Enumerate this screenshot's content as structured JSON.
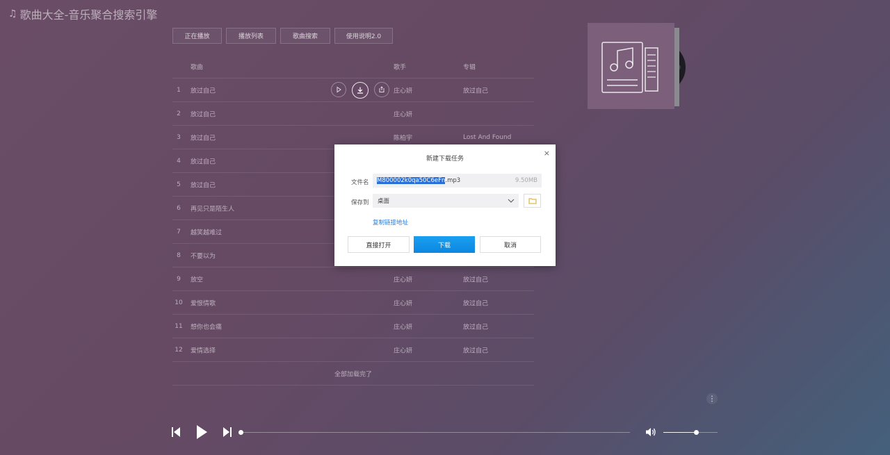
{
  "app": {
    "title": "歌曲大全-音乐聚合搜索引擎"
  },
  "tabs": [
    "正在播放",
    "播放列表",
    "歌曲搜索",
    "使用说明2.0"
  ],
  "list": {
    "headers": {
      "song": "歌曲",
      "singer": "歌手",
      "album": "专辑"
    },
    "rows": [
      {
        "num": "1",
        "song": "放过自己",
        "singer": "庄心妍",
        "album": "放过自己"
      },
      {
        "num": "2",
        "song": "放过自己",
        "singer": "庄心妍",
        "album": ""
      },
      {
        "num": "3",
        "song": "放过自己",
        "singer": "陈柏宇",
        "album": "Lost And Found"
      },
      {
        "num": "4",
        "song": "放过自己",
        "singer": "",
        "album": ""
      },
      {
        "num": "5",
        "song": "放过自己",
        "singer": "",
        "album": ""
      },
      {
        "num": "6",
        "song": "再见只是陌生人",
        "singer": "",
        "album": ""
      },
      {
        "num": "7",
        "song": "越笑越难过",
        "singer": "",
        "album": ""
      },
      {
        "num": "8",
        "song": "不要以为",
        "singer": "",
        "album": ""
      },
      {
        "num": "9",
        "song": "放空",
        "singer": "庄心妍",
        "album": "放过自己"
      },
      {
        "num": "10",
        "song": "爱恨情歌",
        "singer": "庄心妍",
        "album": "放过自己"
      },
      {
        "num": "11",
        "song": "想你也会痛",
        "singer": "庄心妍",
        "album": "放过自己"
      },
      {
        "num": "12",
        "song": "爱情选择",
        "singer": "庄心妍",
        "album": "放过自己"
      }
    ],
    "footer": "全部加载完了"
  },
  "player": {
    "progress": 0,
    "volume": 0.6
  },
  "dialog": {
    "title": "新建下载任务",
    "close": "×",
    "file_label": "文件名",
    "file_name_selected": "M800002k0qa50C6eFn",
    "file_name_ext": ".mp3",
    "file_size": "9.50MB",
    "save_label": "保存到",
    "save_value": "桌面",
    "copy_link": "复制链接地址",
    "btn_open": "直接打开",
    "btn_download": "下载",
    "btn_cancel": "取消"
  },
  "icons": {
    "title": "music-note-icon",
    "cover": "music-document-icon",
    "prev": "skip-previous-icon",
    "play": "play-icon",
    "next": "skip-next-icon",
    "volume": "volume-icon",
    "folder": "folder-icon"
  },
  "colors": {
    "accent": "#0c86e0",
    "link": "#2b7bd8",
    "selection": "#2a6fd6"
  }
}
